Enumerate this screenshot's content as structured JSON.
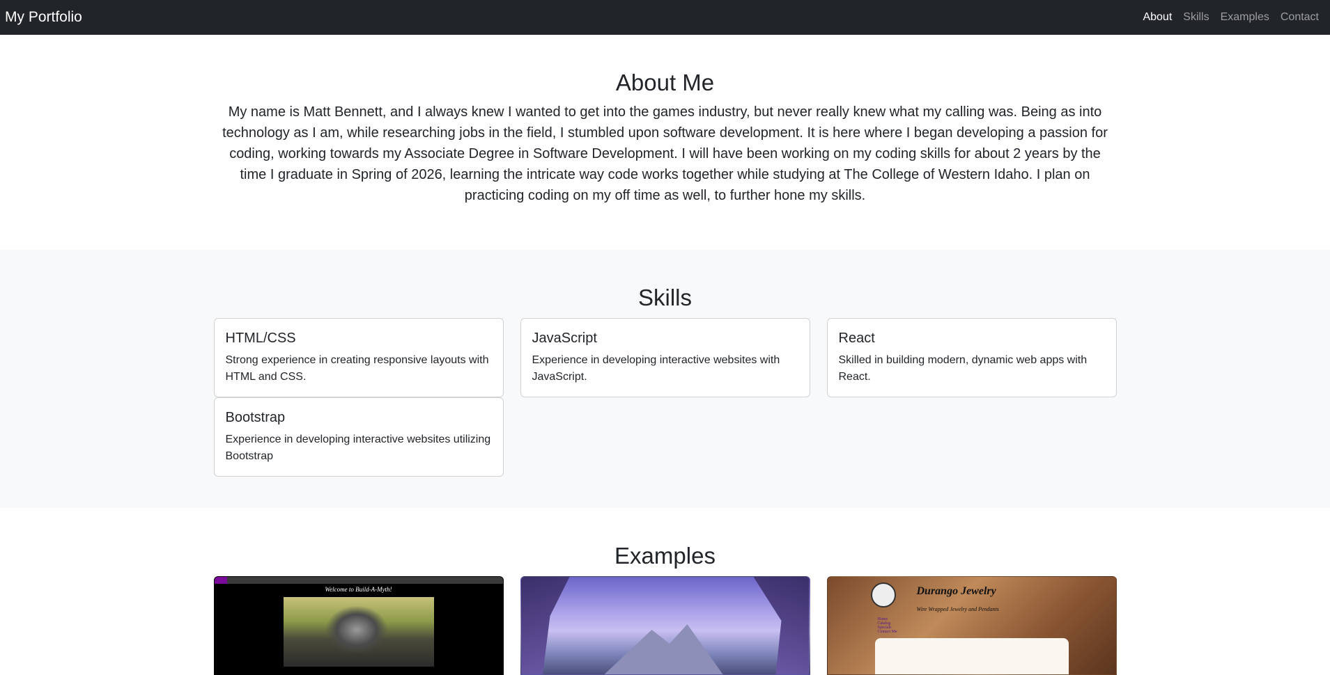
{
  "navbar": {
    "brand": "My Portfolio",
    "links": [
      "About",
      "Skills",
      "Examples",
      "Contact"
    ],
    "active": "About"
  },
  "about": {
    "title": "About Me",
    "text": "My name is Matt Bennett, and I always knew I wanted to get into the games industry, but never really knew what my calling was. Being as into technology as I am, while researching jobs in the field, I stumbled upon software development. It is here where I began developing a passion for coding, working towards my Associate Degree in Software Development. I will have been working on my coding skills for about 2 years by the time I graduate in Spring of 2026, learning the intricate way code works together while studying at The College of Western Idaho. I plan on practicing coding on my off time as well, to further hone my skills."
  },
  "skills": {
    "title": "Skills",
    "items": [
      {
        "title": "HTML/CSS",
        "text": "Strong experience in creating responsive layouts with HTML and CSS."
      },
      {
        "title": "JavaScript",
        "text": "Experience in developing interactive websites with JavaScript."
      },
      {
        "title": "React",
        "text": "Skilled in building modern, dynamic web apps with React."
      },
      {
        "title": "Bootstrap",
        "text": "Experience in developing interactive websites utilizing Bootstrap"
      }
    ]
  },
  "examples": {
    "title": "Examples",
    "ex1": {
      "title": "Welcome to Build-A-Myth!"
    },
    "ex3": {
      "name": "Durango Jewelry",
      "sub": "Wire Wrapped Jewelry and Pendants",
      "menu": [
        "Home",
        "Catalog",
        "Specials",
        "Contact Me"
      ]
    }
  },
  "colors": {
    "navbar": "#212529",
    "section_alt": "#f8f9fa"
  }
}
